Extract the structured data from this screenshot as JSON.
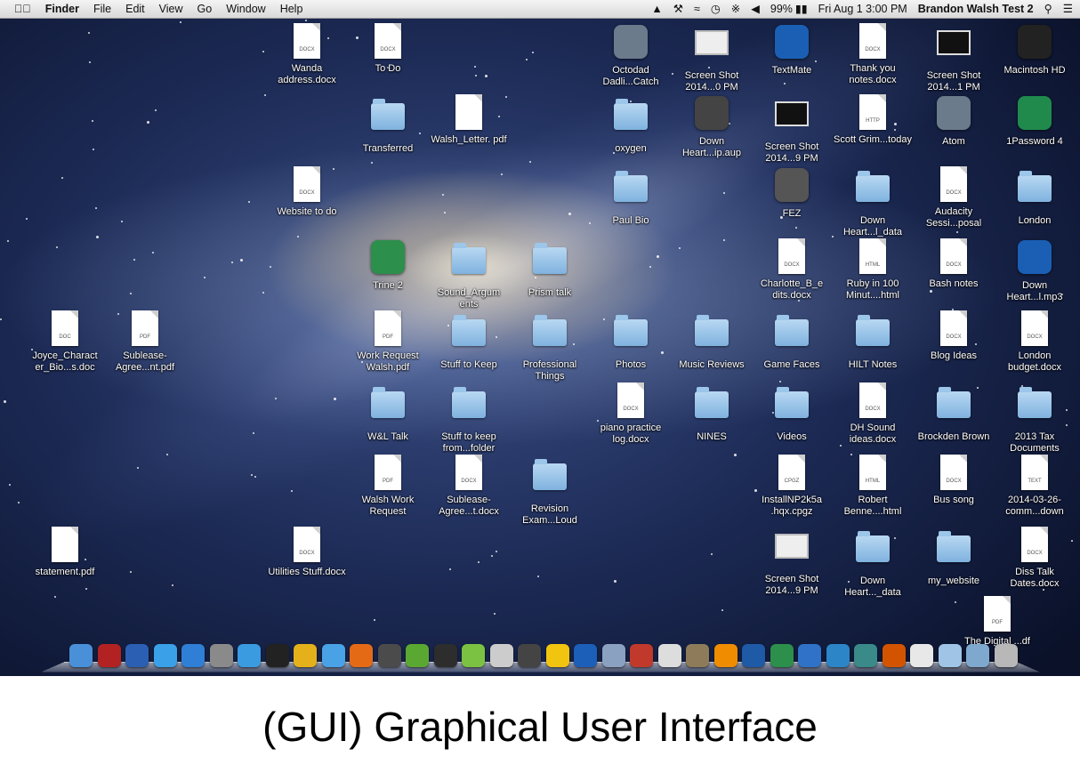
{
  "menubar": {
    "apple": "",
    "items": [
      "Finder",
      "File",
      "Edit",
      "View",
      "Go",
      "Window",
      "Help"
    ],
    "battery": "99%",
    "datetime": "Fri Aug 1  3:00 PM",
    "user": "Brandon Walsh Test 2"
  },
  "desktop_icons": [
    {
      "label": "Wanda address.docx",
      "kind": "doc",
      "tag": "DOCX"
    },
    {
      "label": "To Do",
      "kind": "doc",
      "tag": "DOCX"
    },
    {
      "label": "Octodad Dadli...Catch",
      "kind": "app",
      "tag": ""
    },
    {
      "label": "Screen Shot 2014...0 PM",
      "kind": "screen",
      "tag": ""
    },
    {
      "label": "TextMate",
      "kind": "app",
      "tag": ""
    },
    {
      "label": "Thank you notes.docx",
      "kind": "doc",
      "tag": "DOCX"
    },
    {
      "label": "Screen Shot 2014...1 PM",
      "kind": "screen",
      "tag": ""
    },
    {
      "label": "Macintosh HD",
      "kind": "app",
      "tag": ""
    },
    {
      "label": "Transferred",
      "kind": "folder",
      "tag": ""
    },
    {
      "label": "Walsh_Letter. pdf",
      "kind": "doc",
      "tag": ""
    },
    {
      "label": "oxygen",
      "kind": "folder",
      "tag": ""
    },
    {
      "label": "Down Heart...ip.aup",
      "kind": "app",
      "tag": ""
    },
    {
      "label": "Screen Shot 2014...9 PM",
      "kind": "screen",
      "tag": ""
    },
    {
      "label": "Scott Grim...today",
      "kind": "doc",
      "tag": "HTTP"
    },
    {
      "label": "Atom",
      "kind": "app",
      "tag": ""
    },
    {
      "label": "1Password 4",
      "kind": "app",
      "tag": ""
    },
    {
      "label": "Website to do",
      "kind": "doc",
      "tag": "DOCX"
    },
    {
      "label": "Paul Bio",
      "kind": "folder",
      "tag": ""
    },
    {
      "label": "FEZ",
      "kind": "app",
      "tag": ""
    },
    {
      "label": "Down Heart...l_data",
      "kind": "folder",
      "tag": ""
    },
    {
      "label": "Audacity Sessi...posal",
      "kind": "doc",
      "tag": "DOCX"
    },
    {
      "label": "London",
      "kind": "folder",
      "tag": ""
    },
    {
      "label": "Trine 2",
      "kind": "app",
      "tag": ""
    },
    {
      "label": "Sound_Argum ents",
      "kind": "folder",
      "tag": ""
    },
    {
      "label": "Prism talk",
      "kind": "folder",
      "tag": ""
    },
    {
      "label": "Charlotte_B_e dits.docx",
      "kind": "doc",
      "tag": "DOCX"
    },
    {
      "label": "Ruby in 100 Minut....html",
      "kind": "doc",
      "tag": "HTML"
    },
    {
      "label": "Bash notes",
      "kind": "doc",
      "tag": "DOCX"
    },
    {
      "label": "Down Heart...l.mp3",
      "kind": "app",
      "tag": ""
    },
    {
      "label": "Joyce_Charact er_Bio...s.doc",
      "kind": "doc",
      "tag": "DOC"
    },
    {
      "label": "Sublease- Agree...nt.pdf",
      "kind": "doc",
      "tag": "PDF"
    },
    {
      "label": "Work Request Walsh.pdf",
      "kind": "doc",
      "tag": "PDF"
    },
    {
      "label": "Stuff to Keep",
      "kind": "folder",
      "tag": ""
    },
    {
      "label": "Professional Things",
      "kind": "folder",
      "tag": ""
    },
    {
      "label": "Photos",
      "kind": "folder",
      "tag": ""
    },
    {
      "label": "Music Reviews",
      "kind": "folder",
      "tag": ""
    },
    {
      "label": "Game Faces",
      "kind": "folder",
      "tag": ""
    },
    {
      "label": "HILT Notes",
      "kind": "folder",
      "tag": ""
    },
    {
      "label": "Blog Ideas",
      "kind": "doc",
      "tag": "DOCX"
    },
    {
      "label": "London budget.docx",
      "kind": "doc",
      "tag": "DOCX"
    },
    {
      "label": "W&L Talk",
      "kind": "folder",
      "tag": ""
    },
    {
      "label": "Stuff to keep from...folder",
      "kind": "folder",
      "tag": ""
    },
    {
      "label": "piano practice log.docx",
      "kind": "doc",
      "tag": "DOCX"
    },
    {
      "label": "NINES",
      "kind": "folder",
      "tag": ""
    },
    {
      "label": "Videos",
      "kind": "folder",
      "tag": ""
    },
    {
      "label": "DH Sound ideas.docx",
      "kind": "doc",
      "tag": "DOCX"
    },
    {
      "label": "Brockden Brown",
      "kind": "folder",
      "tag": ""
    },
    {
      "label": "2013 Tax Documents",
      "kind": "folder",
      "tag": ""
    },
    {
      "label": "Walsh Work Request",
      "kind": "doc",
      "tag": "PDF"
    },
    {
      "label": "Sublease- Agree...t.docx",
      "kind": "doc",
      "tag": "DOCX"
    },
    {
      "label": "Revision Exam...Loud",
      "kind": "folder",
      "tag": ""
    },
    {
      "label": "InstallNP2k5a .hqx.cpgz",
      "kind": "doc",
      "tag": "CPGZ"
    },
    {
      "label": "Robert Benne....html",
      "kind": "doc",
      "tag": "HTML"
    },
    {
      "label": "Bus song",
      "kind": "doc",
      "tag": "DOCX"
    },
    {
      "label": "2014-03-26- comm...down",
      "kind": "doc",
      "tag": "TEXT"
    },
    {
      "label": "statement.pdf",
      "kind": "doc",
      "tag": ""
    },
    {
      "label": "Utilities Stuff.docx",
      "kind": "doc",
      "tag": "DOCX"
    },
    {
      "label": "Screen Shot 2014...9 PM",
      "kind": "screen",
      "tag": ""
    },
    {
      "label": "Down Heart..._data",
      "kind": "folder",
      "tag": ""
    },
    {
      "label": "my_website",
      "kind": "folder",
      "tag": ""
    },
    {
      "label": "Diss Talk Dates.docx",
      "kind": "doc",
      "tag": "DOCX"
    },
    {
      "label": "The Digital ...df",
      "kind": "doc",
      "tag": "PDF"
    }
  ],
  "dock_icons": [
    {
      "name": "finder",
      "color": "#4a90d9"
    },
    {
      "name": "photo-booth",
      "color": "#b22222"
    },
    {
      "name": "word",
      "color": "#2b5fb3"
    },
    {
      "name": "itunes",
      "color": "#3aa0e8"
    },
    {
      "name": "app-store",
      "color": "#2f7fd6"
    },
    {
      "name": "system-preferences",
      "color": "#8a8a8a"
    },
    {
      "name": "twitter",
      "color": "#3a9be0"
    },
    {
      "name": "terminal",
      "color": "#222222"
    },
    {
      "name": "chrome",
      "color": "#e5b11a"
    },
    {
      "name": "safari",
      "color": "#4aa2e6"
    },
    {
      "name": "firefox",
      "color": "#e46a16"
    },
    {
      "name": "sublime",
      "color": "#4b4b4b"
    },
    {
      "name": "adium",
      "color": "#5aa832"
    },
    {
      "name": "solitaire",
      "color": "#2d2d2d"
    },
    {
      "name": "spotify",
      "color": "#7cc242"
    },
    {
      "name": "github",
      "color": "#cccccc"
    },
    {
      "name": "steam",
      "color": "#444444"
    },
    {
      "name": "cyberduck",
      "color": "#f1c40f"
    },
    {
      "name": "audacity",
      "color": "#1c5fb8"
    },
    {
      "name": "preview",
      "color": "#8aa1c1"
    },
    {
      "name": "zotero",
      "color": "#c0392b"
    },
    {
      "name": "scrivener",
      "color": "#dddddd"
    },
    {
      "name": "gimp",
      "color": "#8d7b5a"
    },
    {
      "name": "vlc",
      "color": "#f08c00"
    },
    {
      "name": "1password",
      "color": "#1e5aa6"
    },
    {
      "name": "atom",
      "color": "#2c8f4b"
    },
    {
      "name": "x-app",
      "color": "#2f72c7"
    },
    {
      "name": "snowflake-app",
      "color": "#2b85c7"
    },
    {
      "name": "migration",
      "color": "#3a8a8a"
    },
    {
      "name": "powerpoint",
      "color": "#d35400"
    },
    {
      "name": "documents",
      "color": "#e8e8e8"
    },
    {
      "name": "downloads",
      "color": "#9fc4e6"
    },
    {
      "name": "applications",
      "color": "#7fa8cf"
    },
    {
      "name": "trash",
      "color": "#b8b8b8"
    }
  ],
  "caption": "(GUI) Graphical User Interface"
}
